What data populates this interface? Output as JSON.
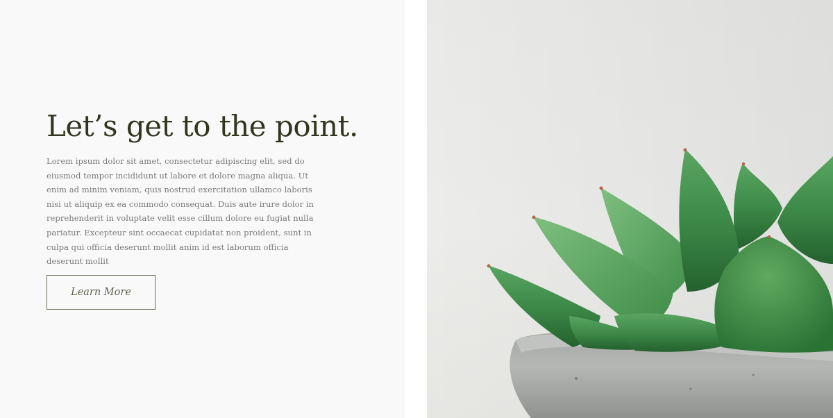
{
  "hero": {
    "headline": "Let’s get to the point.",
    "body": "Lorem ipsum dolor sit amet, consectetur adipiscing elit, sed do eiusmod tempor incididunt ut labore et dolore magna aliqua. Ut enim ad minim veniam, quis nostrud exercitation ullamco laboris nisi ut aliquip ex ea commodo consequat. Duis aute irure dolor in reprehenderit in voluptate velit esse cillum dolore eu fugiat nulla pariatur. Excepteur sint occaecat cupidatat non proident, sunt in culpa qui officia deserunt mollit anim id est laborum officia deserunt mollit",
    "cta_label": "Learn More"
  },
  "image": {
    "subject": "succulent-in-concrete-pot"
  },
  "colors": {
    "headline": "#33351f",
    "body_text": "#7a7a7a",
    "button_border": "#6e6e58",
    "panel_bg": "#f9f9f9"
  }
}
